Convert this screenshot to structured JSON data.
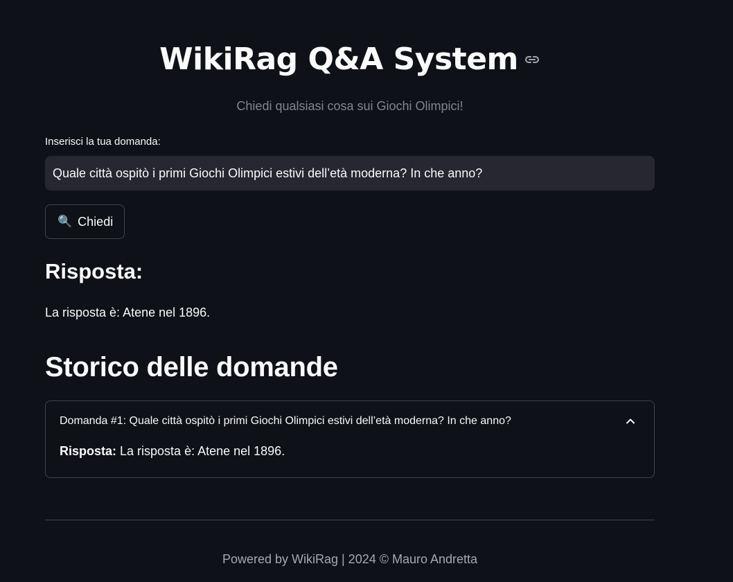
{
  "header": {
    "title": "WikiRag Q&A System",
    "link_icon": "link-icon",
    "subtitle": "Chiedi qualsiasi cosa sui Giochi Olimpici!"
  },
  "question": {
    "label": "Inserisci la tua domanda:",
    "value": "Quale città ospitò i primi Giochi Olimpici estivi dell’età moderna? In che anno?"
  },
  "ask_button": {
    "icon": "🔍",
    "label": "Chiedi"
  },
  "answer": {
    "heading": "Risposta:",
    "text": "La risposta è: Atene nel 1896."
  },
  "history": {
    "heading": "Storico delle domande",
    "items": [
      {
        "title": "Domanda #1: Quale città ospitò i primi Giochi Olimpici estivi dell’età moderna? In che anno?",
        "answer_label": "Risposta:",
        "answer_text": " La risposta è: Atene nel 1896.",
        "expanded": true
      }
    ]
  },
  "footer": {
    "text": "Powered by WikiRag | 2024 © Mauro Andretta"
  },
  "colors": {
    "background": "#0e1117",
    "text": "#fafafa",
    "muted": "#808495",
    "input_bg": "#262730"
  }
}
